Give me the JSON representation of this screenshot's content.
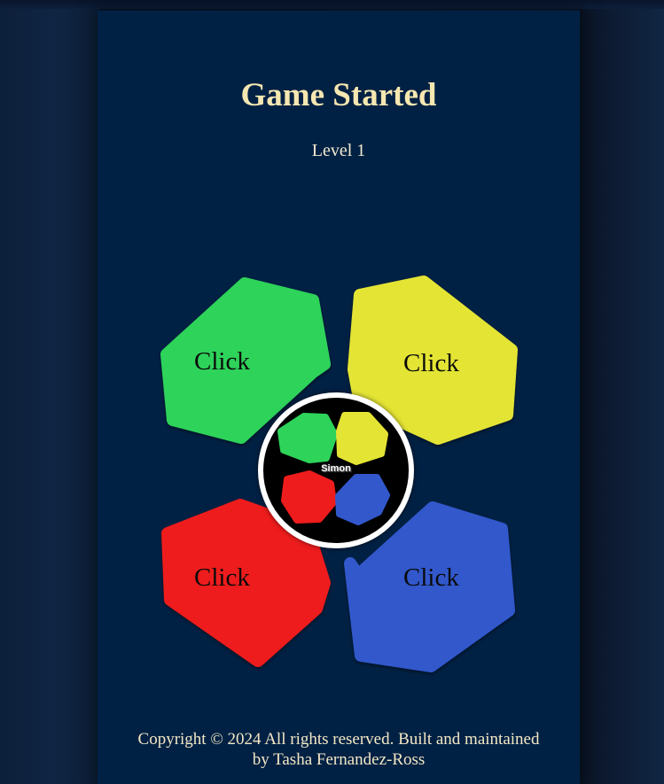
{
  "header": {
    "title": "Game Started",
    "level": "Level 1"
  },
  "pads": {
    "green": {
      "label": "Click",
      "color": "#2ed35a",
      "icon": "green-pad-hexagon"
    },
    "yellow": {
      "label": "Click",
      "color": "#e4e434",
      "icon": "yellow-pad-hexagon"
    },
    "red": {
      "label": "Click",
      "color": "#ee1c1c",
      "icon": "red-pad-hexagon"
    },
    "blue": {
      "label": "Click",
      "color": "#3258cc",
      "icon": "blue-pad-hexagon"
    }
  },
  "center": {
    "logo_text": "Simon",
    "background": "#000000",
    "ring": "#ffffff"
  },
  "footer": {
    "line1": "Copyright © 2024 All rights reserved. Built and maintained",
    "line2": "by Tasha Fernandez-Ross"
  },
  "colors": {
    "page_background": "#0f2543",
    "panel_background": "#012144",
    "title_color": "#f6e7b1"
  }
}
